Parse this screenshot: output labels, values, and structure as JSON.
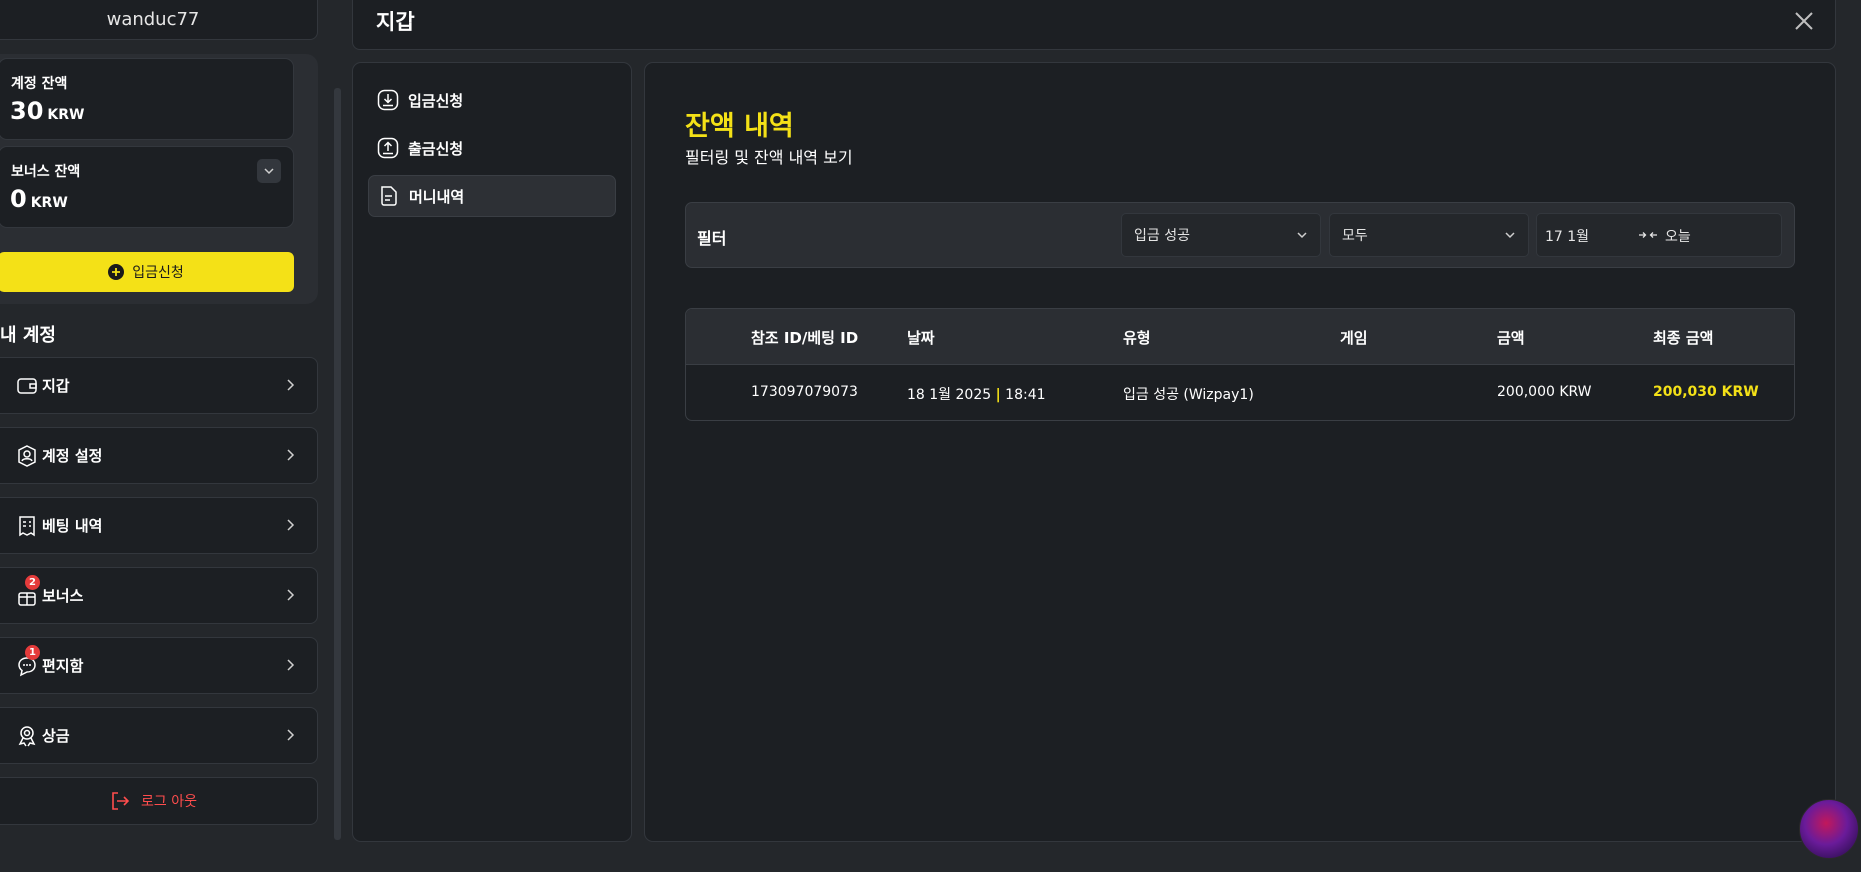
{
  "user": {
    "username": "wanduc77"
  },
  "balances": {
    "account": {
      "label": "계정 잔액",
      "amount": "30",
      "currency": "KRW"
    },
    "bonus": {
      "label": "보너스 잔액",
      "amount": "0",
      "currency": "KRW"
    },
    "deposit_button": "입금신청"
  },
  "my_account": {
    "title": "내 계정",
    "items": [
      {
        "label": "지갑",
        "icon": "wallet-icon",
        "badge": ""
      },
      {
        "label": "계정 설정",
        "icon": "user-settings-icon",
        "badge": ""
      },
      {
        "label": "베팅 내역",
        "icon": "receipt-icon",
        "badge": ""
      },
      {
        "label": "보너스",
        "icon": "gift-icon",
        "badge": "2"
      },
      {
        "label": "편지함",
        "icon": "message-icon",
        "badge": "1"
      },
      {
        "label": "상금",
        "icon": "award-icon",
        "badge": ""
      }
    ],
    "logout": "로그 아웃"
  },
  "modal": {
    "title": "지갑"
  },
  "wallet_nav": {
    "items": [
      {
        "label": "입금신청",
        "icon": "download-icon",
        "active": false
      },
      {
        "label": "출금신청",
        "icon": "upload-icon",
        "active": false
      },
      {
        "label": "머니내역",
        "icon": "document-icon",
        "active": true
      }
    ]
  },
  "history": {
    "title": "잔액 내역",
    "subtitle": "필터링 및 잔액 내역 보기",
    "filter": {
      "label": "필터",
      "type_select": "입금 성공",
      "status_select": "모두",
      "date_from": "17 1월",
      "date_to": "오늘"
    },
    "columns": [
      "참조 ID/베팅 ID",
      "날짜",
      "유형",
      "게임",
      "금액",
      "최종 금액"
    ],
    "rows": [
      {
        "ref_id": "173097079073",
        "date": "18 1월 2025",
        "time": "18:41",
        "type": "입금 성공 (Wizpay1)",
        "game": "",
        "amount": "200,000 KRW",
        "final_amount": "200,030 KRW"
      }
    ]
  },
  "colors": {
    "accent": "#f4e117",
    "danger": "#ff4d4d",
    "background": "#24272b",
    "panel": "#1c1f23"
  }
}
